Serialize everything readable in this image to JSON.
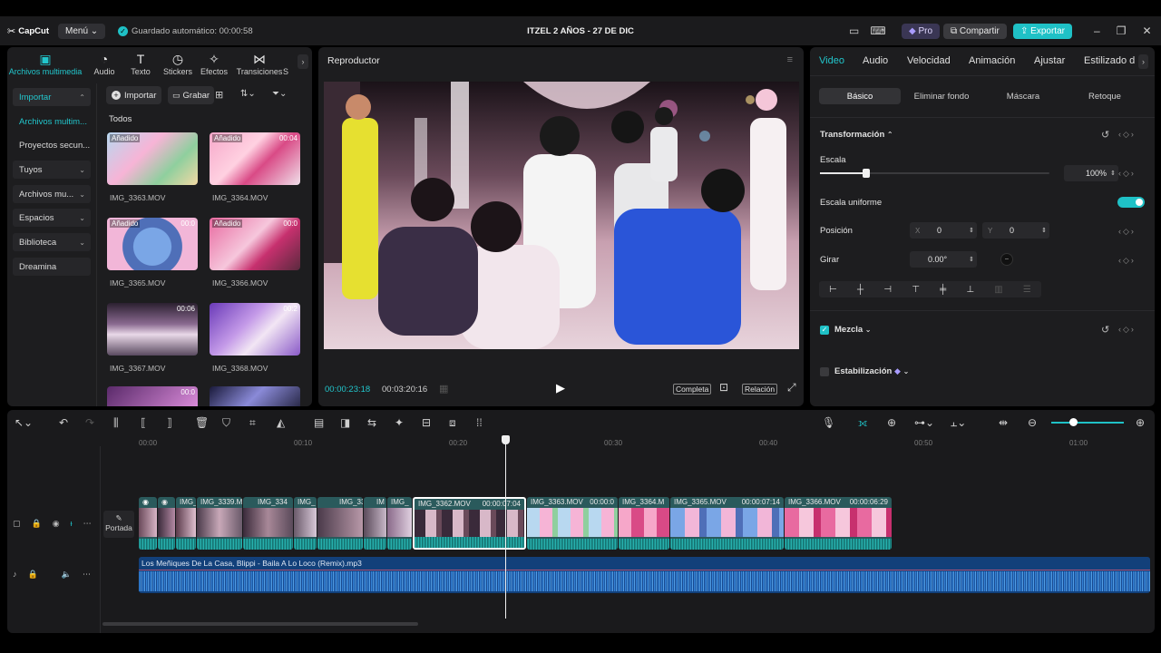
{
  "app": {
    "logo": "CapCut",
    "menu_label": "Menú",
    "autosave": "Guardado automático: 00:00:58",
    "project_title": "ITZEL 2 AÑOS - 27 DE DIC",
    "pro_label": "Pro",
    "share_label": "Compartir",
    "export_label": "Exportar",
    "accent": "#1fc1c6"
  },
  "media_tabs": [
    {
      "label": "Archivos multimedia",
      "icon": "media-icon"
    },
    {
      "label": "Audio",
      "icon": "audio-icon"
    },
    {
      "label": "Texto",
      "icon": "text-icon"
    },
    {
      "label": "Stickers",
      "icon": "sticker-icon"
    },
    {
      "label": "Efectos",
      "icon": "effects-icon"
    },
    {
      "label": "Transiciones",
      "icon": "transition-icon"
    },
    {
      "label": "S",
      "icon": "more-icon"
    }
  ],
  "sidebar": {
    "items": [
      {
        "label": "Importar"
      },
      {
        "label": "Archivos multim..."
      },
      {
        "label": "Proyectos secun..."
      },
      {
        "label": "Tuyos"
      },
      {
        "label": "Archivos mu..."
      },
      {
        "label": "Espacios"
      },
      {
        "label": "Biblioteca"
      },
      {
        "label": "Dreamina"
      }
    ]
  },
  "media": {
    "import_label": "Importar",
    "record_label": "Grabar",
    "all_label": "Todos",
    "items": [
      {
        "name": "IMG_3363.MOV",
        "tag": "Añadido",
        "duration": ""
      },
      {
        "name": "IMG_3364.MOV",
        "tag": "Añadido",
        "duration": "00:04"
      },
      {
        "name": "IMG_3365.MOV",
        "tag": "Añadido",
        "duration": "00:0"
      },
      {
        "name": "IMG_3366.MOV",
        "tag": "Añadido",
        "duration": "00:0"
      },
      {
        "name": "IMG_3367.MOV",
        "tag": "",
        "duration": "00:06"
      },
      {
        "name": "IMG_3368.MOV",
        "tag": "",
        "duration": "00:2"
      },
      {
        "name": "",
        "tag": "",
        "duration": "00:0"
      },
      {
        "name": "",
        "tag": "",
        "duration": ""
      }
    ]
  },
  "player": {
    "title": "Reproductor",
    "current_time": "00:00:23:18",
    "total_time": "00:03:20:16",
    "quality_label": "Completa",
    "ratio_label": "Relación"
  },
  "properties": {
    "tabs": [
      "Video",
      "Audio",
      "Velocidad",
      "Animación",
      "Ajustar",
      "Estilizado d"
    ],
    "subtabs": [
      "Básico",
      "Eliminar fondo",
      "Máscara",
      "Retoque"
    ],
    "transform_label": "Transformación",
    "scale_label": "Escala",
    "scale_value": "100%",
    "scale_fraction": 0.2,
    "uniform_scale_label": "Escala uniforme",
    "position_label": "Posición",
    "pos_x_label": "X",
    "pos_x": "0",
    "pos_y_label": "Y",
    "pos_y": "0",
    "rotate_label": "Girar",
    "rotate_value": "0.00°",
    "blend_label": "Mezcla",
    "stabilization_label": "Estabilización"
  },
  "timeline": {
    "ruler": [
      "00:00",
      "00:10",
      "00:20",
      "00:30",
      "00:40",
      "00:50",
      "01:00"
    ],
    "cover_label": "Portada",
    "clips": [
      {
        "name": "IMG_",
        "duration": ""
      },
      {
        "name": "IMG_3339.M",
        "duration": ""
      },
      {
        "name": "IMG_334",
        "duration": ""
      },
      {
        "name": "IMG_",
        "duration": ""
      },
      {
        "name": "IMG_33",
        "duration": ""
      },
      {
        "name": "IM",
        "duration": ""
      },
      {
        "name": "IMG_",
        "duration": ""
      },
      {
        "name": "IMG_3362.MOV",
        "duration": "00:00:07:04"
      },
      {
        "name": "IMG_3363.MOV",
        "duration": "00:00:0"
      },
      {
        "name": "IMG_3364.M",
        "duration": ""
      },
      {
        "name": "IMG_3365.MOV",
        "duration": "00:00:07:14"
      },
      {
        "name": "IMG_3366.MOV",
        "duration": "00:00:06:29"
      }
    ],
    "audio_name": "Los Meñiques De La Casa, Blippi - Baila A Lo Loco (Remix).mp3"
  }
}
